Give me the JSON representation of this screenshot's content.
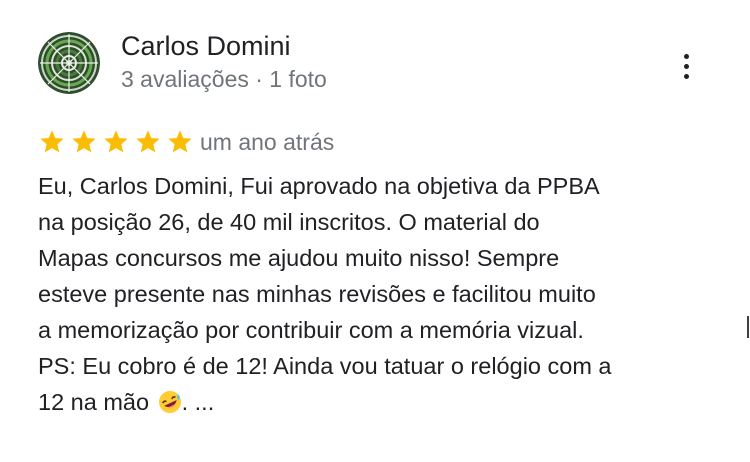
{
  "reviewer": {
    "name": "Carlos Domini",
    "meta": "3 avaliações · 1 foto",
    "avatar_icon": "patterned-avatar-icon"
  },
  "menu": {
    "icon": "more-vert-icon"
  },
  "rating": {
    "stars": 5,
    "max": 5,
    "color": "#fbbc04"
  },
  "review": {
    "date": "um ano atrás",
    "lines": [
      "Eu, Carlos Domini, Fui aprovado na objetiva da PPBA",
      "na posição 26, de 40 mil inscritos. O material do",
      "Mapas concursos me ajudou muito nisso! Sempre",
      "esteve presente nas minhas revisões e facilitou muito",
      "a memorização por contribuir com a memória vizual.",
      "PS: Eu cobro é de 12! Ainda vou tatuar o relógio com a",
      "12 na mão"
    ],
    "ellipsis": ". ...",
    "emoji_icon": "rofl-face-emoji"
  }
}
